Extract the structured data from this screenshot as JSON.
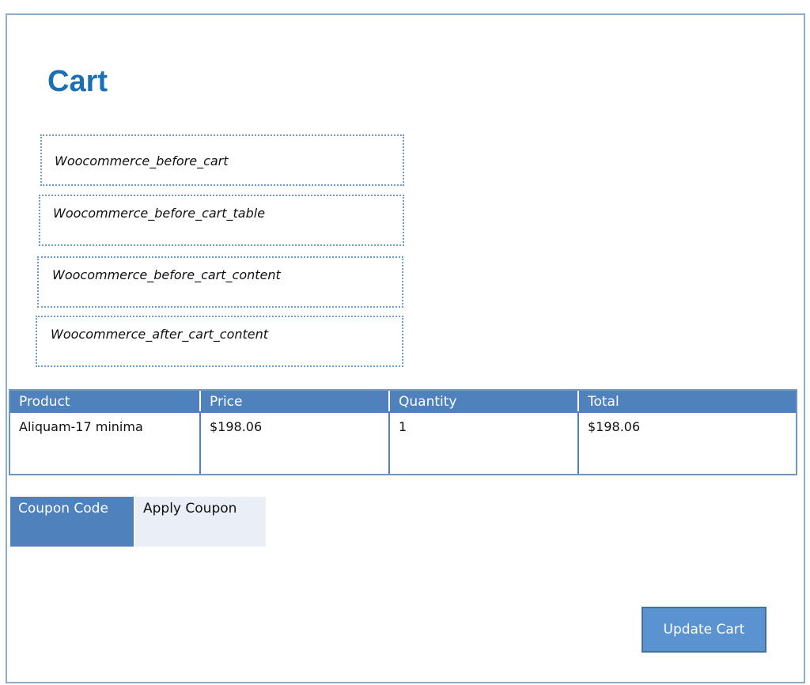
{
  "page": {
    "title": "Cart"
  },
  "hooks": [
    "Woocommerce_before_cart",
    "Woocommerce_before_cart_table",
    "Woocommerce_before_cart_content",
    "Woocommerce_after_cart_content"
  ],
  "cart_table": {
    "columns": [
      "Product",
      "Price",
      "Quantity",
      "Total"
    ],
    "rows": [
      [
        "Aliquam-17 minima",
        "$198.06",
        "1",
        "$198.06"
      ]
    ]
  },
  "coupon": {
    "label": "Coupon Code",
    "apply_label": "Apply Coupon"
  },
  "actions": {
    "update_cart_label": "Update Cart"
  },
  "colors": {
    "accent": "#4f81bd",
    "title": "#1a6fb5",
    "button": "#5b93d0",
    "frame_border": "#8aaecb"
  }
}
